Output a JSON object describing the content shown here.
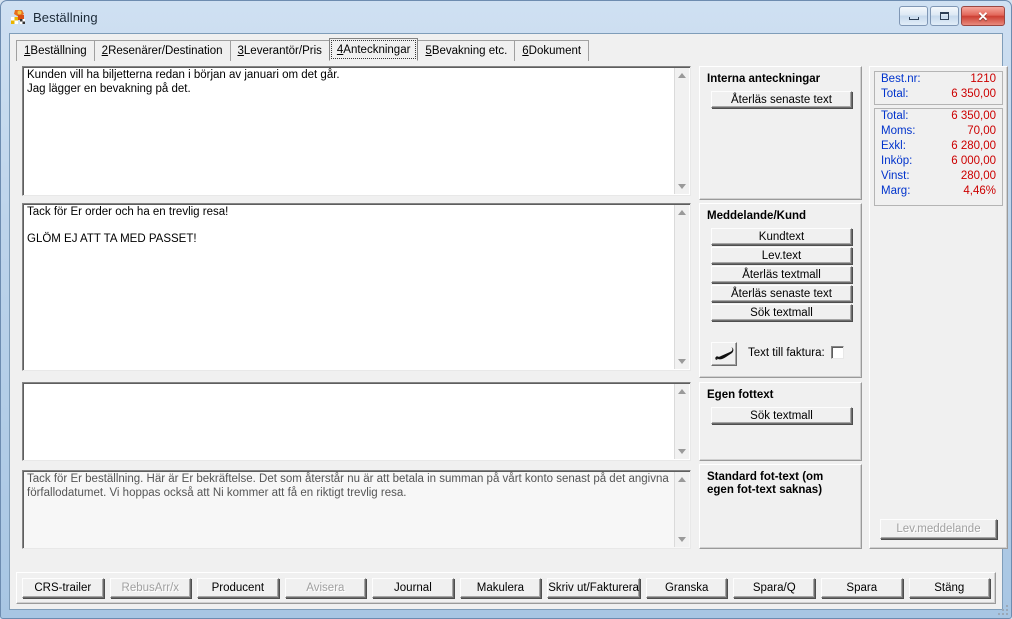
{
  "window": {
    "title": "Beställning",
    "icon": "app-icon",
    "buttons": {
      "minimize": "minimize-icon",
      "maximize": "maximize-icon",
      "close": "✕"
    }
  },
  "tabs": [
    {
      "num": "1",
      "label": " Beställning",
      "active": false
    },
    {
      "num": "2",
      "label": " Resenärer/Destination",
      "active": false
    },
    {
      "num": "3",
      "label": " Leverantör/Pris",
      "active": false
    },
    {
      "num": "4",
      "label": " Anteckningar",
      "active": true
    },
    {
      "num": "5",
      "label": " Bevakning etc.",
      "active": false
    },
    {
      "num": "6",
      "label": " Dokument",
      "active": false
    }
  ],
  "editors": {
    "internal_notes": "Kunden vill ha biljetterna redan i början av januari om det går.\nJag lägger en bevakning på det.",
    "customer_message": "Tack för Er order och ha en trevlig resa!\n\nGLÖM EJ ATT TA MED PASSET!",
    "own_footer": "",
    "standard_footer": "Tack för Er beställning. Här är Er bekräftelse. Det som återstår nu är att betala in summan på vårt konto senast på det angivna förfallodatumet. Vi hoppas också att Ni kommer att få en riktigt trevlig resa."
  },
  "panels": {
    "internal": {
      "title": "Interna anteckningar",
      "buttons": [
        "Återläs senaste text"
      ]
    },
    "message": {
      "title": "Meddelande/Kund",
      "buttons": [
        "Kundtext",
        "Lev.text",
        "Återläs textmall",
        "Återläs senaste text",
        "Sök textmall"
      ],
      "pen_icon": "pen-icon",
      "invoice_text_label": "Text till faktura:",
      "invoice_text_checked": false
    },
    "own_footer": {
      "title": "Egen fottext",
      "buttons": [
        "Sök textmall"
      ]
    },
    "standard_footer": {
      "title": "Standard fot-text (om egen fot-text saknas)"
    },
    "lev_message_button": {
      "label": "Lev.meddelande",
      "disabled": true
    }
  },
  "summary": {
    "top": [
      {
        "label": "Best.nr:",
        "value": "1210"
      },
      {
        "label": "Total:",
        "value": "6 350,00"
      }
    ],
    "bottom": [
      {
        "label": "Total:",
        "value": "6 350,00"
      },
      {
        "label": "Moms:",
        "value": "70,00"
      },
      {
        "label": "Exkl:",
        "value": "6 280,00"
      },
      {
        "label": "Inköp:",
        "value": "6 000,00"
      },
      {
        "label": "Vinst:",
        "value": "280,00"
      },
      {
        "label": "Marg:",
        "value": "4,46%"
      }
    ],
    "label_color": "#0033cc",
    "value_color": "#cc0000"
  },
  "bottom_buttons": [
    {
      "label": "CRS-trailer",
      "accel": "a",
      "disabled": false
    },
    {
      "label": "RebusArr/x",
      "accel": "x",
      "disabled": true
    },
    {
      "label": "Producent",
      "accel": "t",
      "disabled": false
    },
    {
      "label": "Avisera",
      "accel": "",
      "disabled": true
    },
    {
      "label": "Journal",
      "accel": "J",
      "disabled": false
    },
    {
      "label": "Makulera",
      "accel": "a",
      "disabled": false
    },
    {
      "label": "Skriv ut/Fakturera",
      "accel": "S",
      "disabled": false
    },
    {
      "label": "Granska",
      "accel": "G",
      "disabled": false
    },
    {
      "label": "Spara/Q",
      "accel": "Q",
      "disabled": false
    },
    {
      "label": "Spara",
      "accel": "p",
      "disabled": false
    },
    {
      "label": "Stäng",
      "accel": "n",
      "disabled": false
    }
  ]
}
